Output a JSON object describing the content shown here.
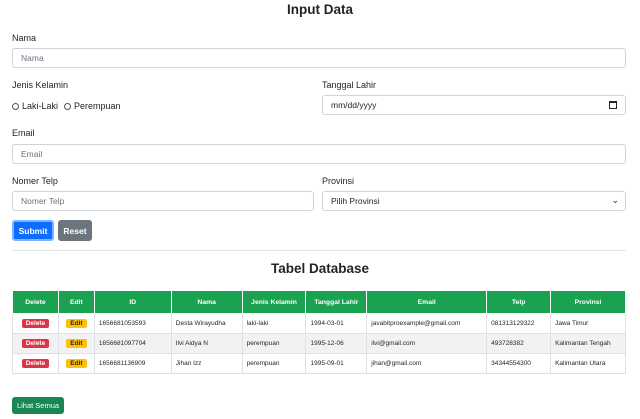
{
  "form": {
    "title": "Input Data",
    "nama": {
      "label": "Nama",
      "placeholder": "Nama"
    },
    "jenis_kelamin": {
      "label": "Jenis Kelamin",
      "options": [
        "Laki-Laki",
        "Perempuan"
      ]
    },
    "tanggal_lahir": {
      "label": "Tanggal Lahir",
      "placeholder": "mm/dd/yyyy"
    },
    "email": {
      "label": "Email",
      "placeholder": "Email"
    },
    "telp": {
      "label": "Nomer Telp",
      "placeholder": "Nomer Telp"
    },
    "provinsi": {
      "label": "Provinsi",
      "selected": "Pilih Provinsi"
    },
    "submit_label": "Submit",
    "reset_label": "Reset"
  },
  "table": {
    "title": "Tabel Database",
    "headers": [
      "Delete",
      "Edit",
      "ID",
      "Nama",
      "Jenis Kelamin",
      "Tanggal Lahir",
      "Email",
      "Telp",
      "Provinsi"
    ],
    "delete_label": "Delete",
    "edit_label": "Edit",
    "rows": [
      [
        "1656681053593",
        "Desta Wirayudha",
        "laki-laki",
        "1994-03-01",
        "javabitproexample@gmail.com",
        "081313129322",
        "Jawa Timur"
      ],
      [
        "1656681097704",
        "Ilvi Aidya N",
        "perempuan",
        "1995-12-06",
        "ilvi@gmail.com",
        "493728382",
        "Kalimantan Tengah"
      ],
      [
        "1656681136909",
        "Jihan Izz",
        "perempuan",
        "1995-09-01",
        "jihan@gmail.com",
        "34344554300",
        "Kalimantan Utara"
      ]
    ]
  },
  "lihat_semua_label": "Lihat Semua",
  "colors": {
    "primary": "#0d6efd",
    "secondary": "#6c757d",
    "table_header": "#1aa251",
    "danger": "#dc3545",
    "warning": "#ffc107",
    "success": "#198754"
  }
}
